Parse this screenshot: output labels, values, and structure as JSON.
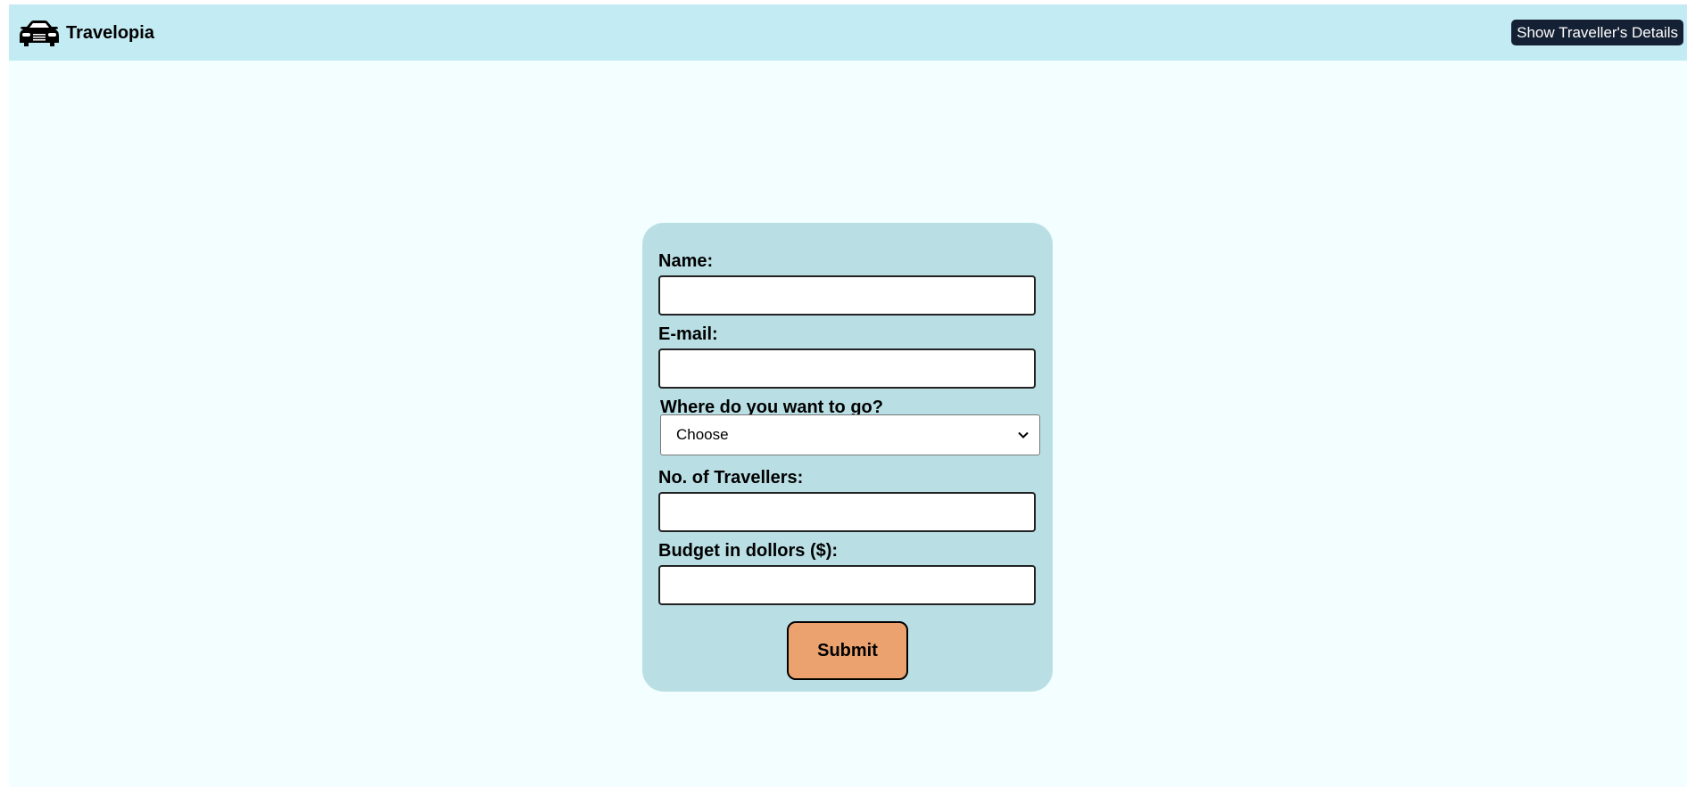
{
  "navbar": {
    "brand_icon": "car-icon",
    "brand_name": "Travelopia",
    "details_button_label": "Show Traveller's Details"
  },
  "form": {
    "name_label": "Name:",
    "name_value": "",
    "email_label": "E-mail:",
    "email_value": "",
    "destination_label": "Where do you want to go?",
    "destination_selected": "Choose",
    "travellers_label": "No. of Travellers:",
    "travellers_value": "",
    "budget_label": "Budget in dollors ($):",
    "budget_value": "",
    "submit_label": "Submit"
  },
  "colors": {
    "navbar_bg": "#c3ebf3",
    "page_bg": "#f2feff",
    "card_bg": "#b9dfe5",
    "details_button_bg": "#142033",
    "submit_bg": "#eca26f"
  }
}
